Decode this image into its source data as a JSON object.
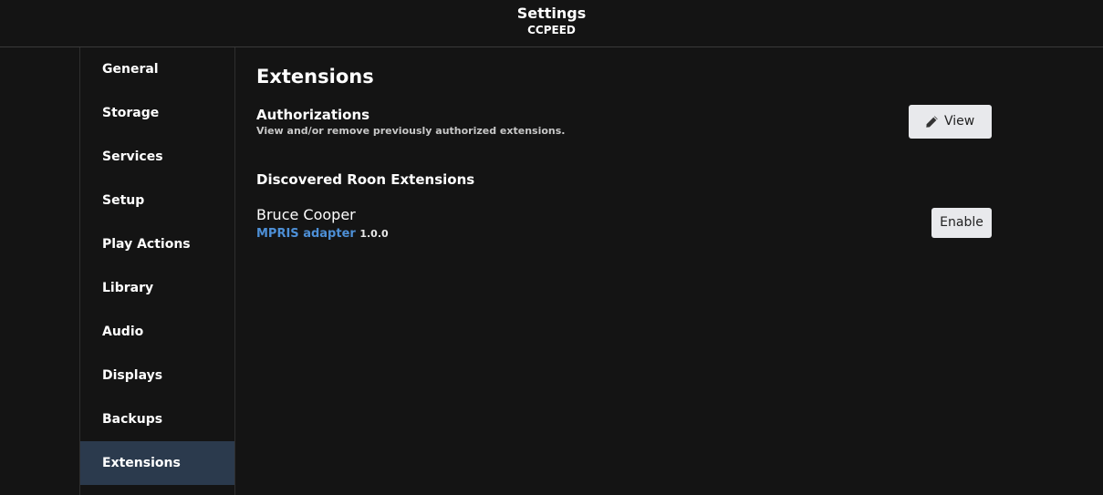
{
  "header": {
    "title": "Settings",
    "subtitle": "CCPEED"
  },
  "sidebar": {
    "items": [
      {
        "label": "General"
      },
      {
        "label": "Storage"
      },
      {
        "label": "Services"
      },
      {
        "label": "Setup"
      },
      {
        "label": "Play Actions"
      },
      {
        "label": "Library"
      },
      {
        "label": "Audio"
      },
      {
        "label": "Displays"
      },
      {
        "label": "Backups"
      },
      {
        "label": "Extensions",
        "active": true
      }
    ]
  },
  "main": {
    "title": "Extensions",
    "authorizations": {
      "title": "Authorizations",
      "description": "View and/or remove previously authorized extensions.",
      "button_label": "View",
      "button_icon": "pencil-icon"
    },
    "discovered": {
      "title": "Discovered Roon Extensions",
      "extensions": [
        {
          "author": "Bruce Cooper",
          "name": "MPRIS adapter",
          "version": "1.0.0",
          "button_label": "Enable"
        }
      ]
    }
  },
  "colors": {
    "background": "#141414",
    "active_item": "#2b3a4d",
    "link": "#4d8fd6",
    "button": "#e8e9ec"
  }
}
